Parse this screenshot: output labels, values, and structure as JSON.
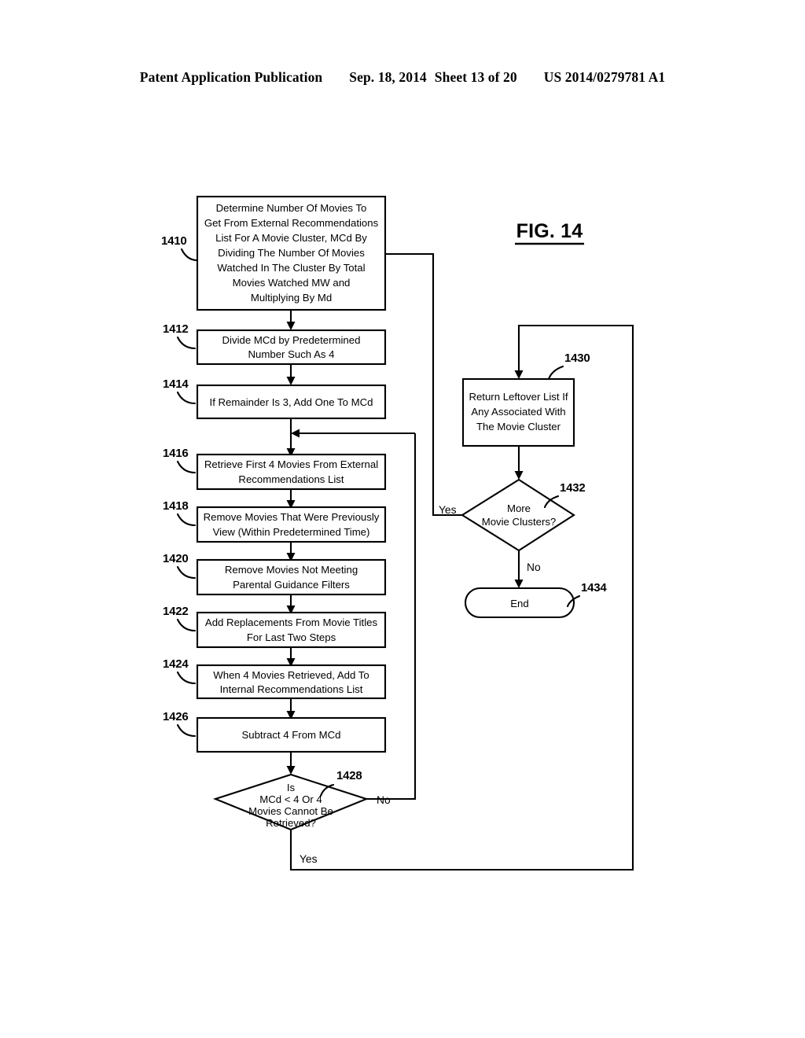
{
  "header": {
    "publication": "Patent Application Publication",
    "date": "Sep. 18, 2014",
    "sheet": "Sheet 13 of 20",
    "patent_number": "US 2014/0279781 A1"
  },
  "figure": {
    "title": "FIG. 14"
  },
  "nodes": [
    {
      "id": "1410",
      "ref": "1410",
      "shape": "process",
      "lines": [
        "Determine Number Of Movies To",
        "Get From External Recommendations",
        "List For A Movie Cluster, MCd By",
        "Dividing The Number Of Movies",
        "Watched In The Cluster By Total",
        "Movies Watched MW and",
        "Multiplying By Md"
      ]
    },
    {
      "id": "1412",
      "ref": "1412",
      "shape": "process",
      "lines": [
        "Divide MCd by Predetermined",
        "Number Such As 4"
      ]
    },
    {
      "id": "1414",
      "ref": "1414",
      "shape": "process",
      "lines": [
        "If Remainder Is 3, Add One To MCd"
      ]
    },
    {
      "id": "1416",
      "ref": "1416",
      "shape": "process",
      "lines": [
        "Retrieve First 4 Movies From External",
        "Recommendations List"
      ]
    },
    {
      "id": "1418",
      "ref": "1418",
      "shape": "process",
      "lines": [
        "Remove Movies That Were Previously",
        "View (Within Predetermined Time)"
      ]
    },
    {
      "id": "1420",
      "ref": "1420",
      "shape": "process",
      "lines": [
        "Remove Movies Not Meeting",
        "Parental Guidance Filters"
      ]
    },
    {
      "id": "1422",
      "ref": "1422",
      "shape": "process",
      "lines": [
        "Add Replacements From Movie Titles",
        "For Last Two Steps"
      ]
    },
    {
      "id": "1424",
      "ref": "1424",
      "shape": "process",
      "lines": [
        "When 4 Movies Retrieved, Add To",
        "Internal Recommendations List"
      ]
    },
    {
      "id": "1426",
      "ref": "1426",
      "shape": "process",
      "lines": [
        "Subtract 4 From MCd"
      ]
    },
    {
      "id": "1428",
      "ref": "1428",
      "shape": "decision",
      "lines": [
        "Is",
        "MCd < 4 Or 4",
        "Movies Cannot Be",
        "Retrieved?"
      ]
    },
    {
      "id": "1430",
      "ref": "1430",
      "shape": "process",
      "lines": [
        "Return Leftover List If",
        "Any Associated With",
        "The Movie Cluster"
      ]
    },
    {
      "id": "1432",
      "ref": "1432",
      "shape": "decision",
      "lines": [
        "More",
        "Movie Clusters?"
      ]
    },
    {
      "id": "1434",
      "ref": "1434",
      "shape": "terminator",
      "lines": [
        "End"
      ]
    }
  ],
  "edge_labels": {
    "decision_1428_no": "No",
    "decision_1428_yes": "Yes",
    "decision_1432_yes": "Yes",
    "decision_1432_no": "No"
  },
  "colors": {
    "ink": "#000000",
    "paper": "#ffffff"
  }
}
